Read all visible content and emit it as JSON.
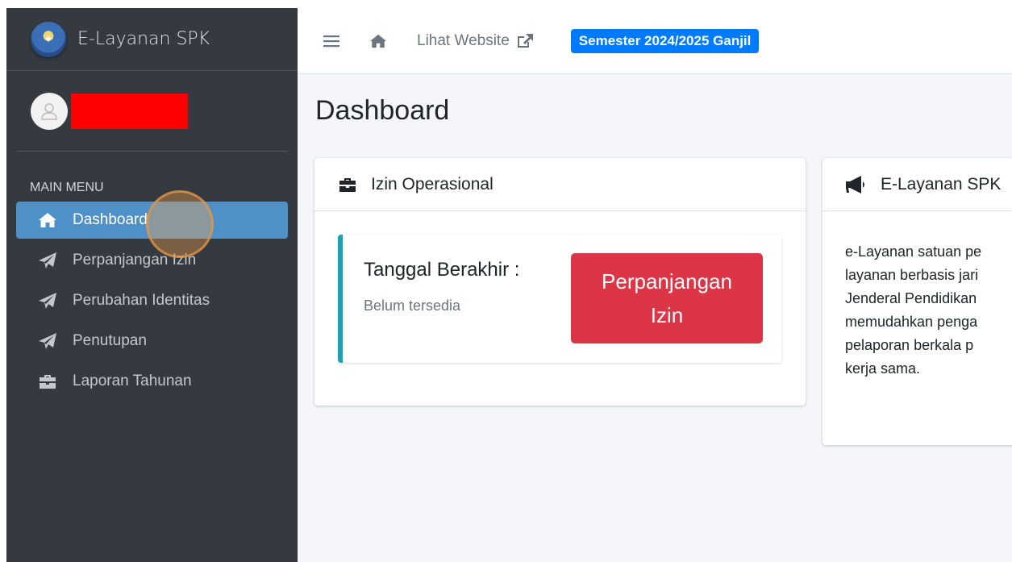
{
  "brand": {
    "title": "E-Layanan SPK"
  },
  "sidebar": {
    "menu_header": "MAIN MENU",
    "items": [
      {
        "label": "Dashboard",
        "icon": "home-icon",
        "active": true
      },
      {
        "label": "Perpanjangan Izin",
        "icon": "paper-plane-icon"
      },
      {
        "label": "Perubahan Identitas",
        "icon": "paper-plane-icon"
      },
      {
        "label": "Penutupan",
        "icon": "paper-plane-icon"
      },
      {
        "label": "Laporan Tahunan",
        "icon": "briefcase-icon"
      }
    ]
  },
  "navbar": {
    "website_link": "Lihat Website",
    "semester_badge": "Semester 2024/2025 Ganjil"
  },
  "page": {
    "title": "Dashboard"
  },
  "izin_card": {
    "header": "Izin Operasional",
    "tanggal_label": "Tanggal Berakhir :",
    "tanggal_value": "Belum tersedia",
    "button_label": "Perpanjangan Izin"
  },
  "info_card": {
    "header": "E-Layanan SPK",
    "lines": [
      "e-Layanan satuan pe",
      "layanan berbasis jari",
      "Jenderal Pendidikan",
      "memudahkan penga",
      "pelaporan berkala p",
      "kerja sama."
    ]
  },
  "colors": {
    "sidebar_bg": "#343a40",
    "active_item": "#4e91c8",
    "badge": "#007bff",
    "danger_button": "#dc3545",
    "callout_border": "#17a2b8"
  }
}
